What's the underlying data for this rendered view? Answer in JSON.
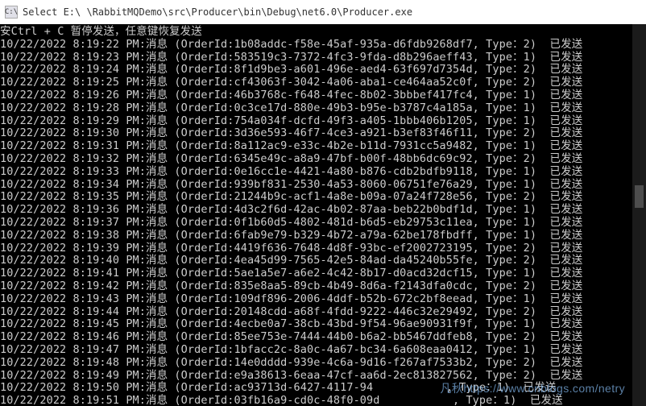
{
  "window": {
    "icon_label": "C:\\",
    "title": "Select E:\\    \\RabbitMQDemo\\src\\Producer\\bin\\Debug\\net6.0\\Producer.exe"
  },
  "header_line": "安Ctrl + C 暂停发送，任意键恢复发送",
  "rows": [
    {
      "ts": "10/22/2022 8:19:22 PM",
      "order": "1b08addc-f58e-45af-935a-d6fdb9268df7",
      "type": "2"
    },
    {
      "ts": "10/22/2022 8:19:23 PM",
      "order": "583519c3-7372-4fc3-9fda-d8b296aeff43",
      "type": "1"
    },
    {
      "ts": "10/22/2022 8:19:24 PM",
      "order": "8f1d9be3-a601-496e-aed4-63f697d7354d",
      "type": "2"
    },
    {
      "ts": "10/22/2022 8:19:25 PM",
      "order": "cf43063f-3042-4a06-aba1-ce464aa52c0f",
      "type": "2"
    },
    {
      "ts": "10/22/2022 8:19:26 PM",
      "order": "46b3768c-f648-4fec-8b02-3bbbef417fc4",
      "type": "1"
    },
    {
      "ts": "10/22/2022 8:19:28 PM",
      "order": "0c3ce17d-880e-49b3-b95e-b3787c4a185a",
      "type": "1"
    },
    {
      "ts": "10/22/2022 8:19:29 PM",
      "order": "754a034f-dcfd-49f3-a405-1bbb406b1205",
      "type": "1"
    },
    {
      "ts": "10/22/2022 8:19:30 PM",
      "order": "3d36e593-46f7-4ce3-a921-b3ef83f46f11",
      "type": "2"
    },
    {
      "ts": "10/22/2022 8:19:31 PM",
      "order": "8a112ac9-e33c-4b2e-b11d-7931cc5a9482",
      "type": "1"
    },
    {
      "ts": "10/22/2022 8:19:32 PM",
      "order": "6345e49c-a8a9-47bf-b00f-48bb6dc69c92",
      "type": "2"
    },
    {
      "ts": "10/22/2022 8:19:33 PM",
      "order": "0e16cc1e-4421-4a80-b876-cdb2bdfb9118",
      "type": "1"
    },
    {
      "ts": "10/22/2022 8:19:34 PM",
      "order": "939bf831-2530-4a53-8060-06751fe76a29",
      "type": "1"
    },
    {
      "ts": "10/22/2022 8:19:35 PM",
      "order": "21244b9c-acf1-4a8e-b09a-07a24f728e56",
      "type": "2"
    },
    {
      "ts": "10/22/2022 8:19:36 PM",
      "order": "4d3c2f6d-42ac-4b02-87aa-beb22b0bdf1d",
      "type": "1"
    },
    {
      "ts": "10/22/2022 8:19:37 PM",
      "order": "0f1b60d5-4802-481d-b6d5-eb29753c11ea",
      "type": "1"
    },
    {
      "ts": "10/22/2022 8:19:38 PM",
      "order": "6fab9e79-b329-4b72-a79a-62be178fbdff",
      "type": "1"
    },
    {
      "ts": "10/22/2022 8:19:39 PM",
      "order": "4419f636-7648-4d8f-93bc-ef2002723195",
      "type": "2"
    },
    {
      "ts": "10/22/2022 8:19:40 PM",
      "order": "4ea45d99-7565-42e5-84ad-da45240b55fe",
      "type": "2"
    },
    {
      "ts": "10/22/2022 8:19:41 PM",
      "order": "5ae1a5e7-a6e2-4c42-8b17-d0acd32dcf15",
      "type": "1"
    },
    {
      "ts": "10/22/2022 8:19:42 PM",
      "order": "835e8aa5-89cb-4b49-8d6a-f2143dfa0cdc",
      "type": "2"
    },
    {
      "ts": "10/22/2022 8:19:43 PM",
      "order": "109df896-2006-4ddf-b52b-672c2bf8eead",
      "type": "1"
    },
    {
      "ts": "10/22/2022 8:19:44 PM",
      "order": "20148cdd-a68f-4fdd-9222-446c32e29492",
      "type": "2"
    },
    {
      "ts": "10/22/2022 8:19:45 PM",
      "order": "4ecbe0a7-38cb-43bd-9f54-96ae90931f9f",
      "type": "1"
    },
    {
      "ts": "10/22/2022 8:19:46 PM",
      "order": "85ee753e-7444-44b0-b6a2-bb5467ddfeb8",
      "type": "2"
    },
    {
      "ts": "10/22/2022 8:19:47 PM",
      "order": "1bfacc2c-8a0c-4a67-bc34-6a608eaa0412",
      "type": "1"
    },
    {
      "ts": "10/22/2022 8:19:48 PM",
      "order": "14e0dddd-939e-4c6a-9d16-f267af7533b2",
      "type": "2"
    },
    {
      "ts": "10/22/2022 8:19:49 PM",
      "order": "e9a38613-6eaa-47cf-aa6d-2ec813827562",
      "type": "2"
    },
    {
      "ts": "10/22/2022 8:19:50 PM",
      "order": "ac93713d-6427-4117-94           ",
      "type": "1"
    },
    {
      "ts": "10/22/2022 8:19:51 PM",
      "order": "03fb16a9-cd0c-48f0-09d           ",
      "type": "1"
    }
  ],
  "labels": {
    "msg": "消息",
    "order_prefix": "(OrderId:",
    "type_prefix": ", Type：",
    "suffix": ")",
    "sent": "已发送"
  },
  "watermark": "凡秋https://www.cnblogs.com/netry"
}
